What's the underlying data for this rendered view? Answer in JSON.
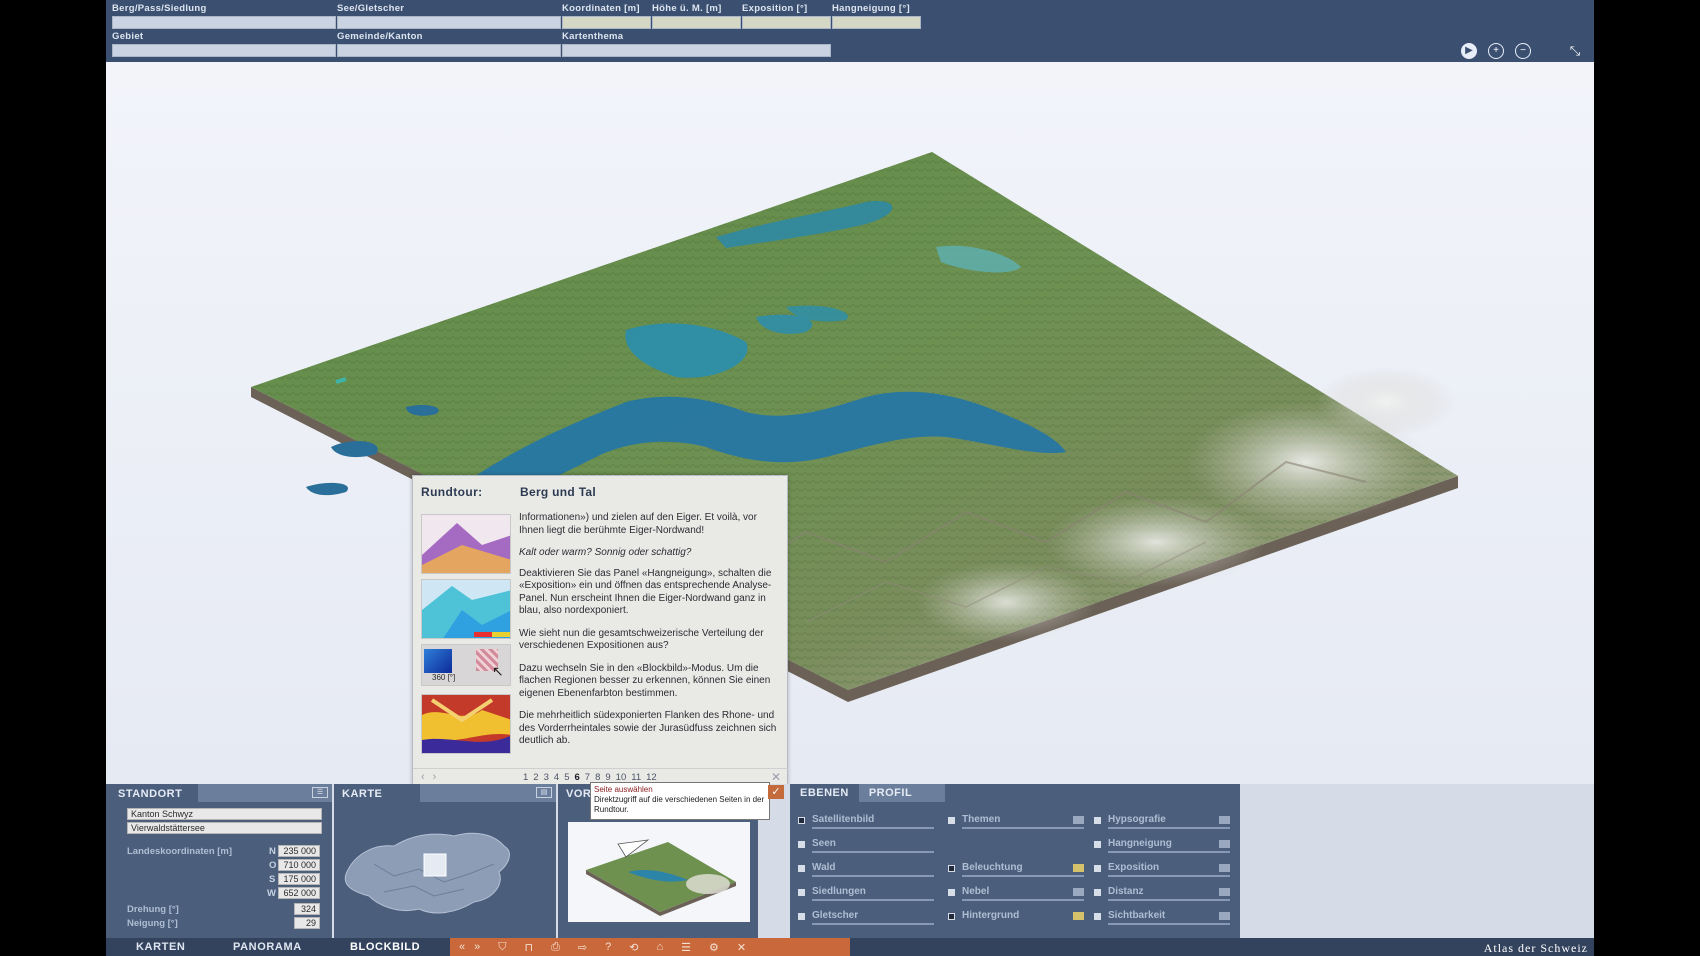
{
  "topbar": {
    "fields": [
      {
        "label": "Berg/Pass/Siedlung"
      },
      {
        "label": "See/Gletscher"
      },
      {
        "label": "Koordinaten [m]"
      },
      {
        "label": "Höhe ü. M. [m]"
      },
      {
        "label": "Exposition [°]"
      },
      {
        "label": "Hangneigung [°]"
      },
      {
        "label": "Gebiet"
      },
      {
        "label": "Gemeinde/Kanton"
      },
      {
        "label": "Kartenthema"
      }
    ],
    "icons": [
      "play-icon",
      "zoom-in-icon",
      "zoom-out-icon",
      "fullscreen-icon"
    ]
  },
  "tour": {
    "label": "Rundtour:",
    "title": "Berg und Tal",
    "paragraphs": [
      "Informationen») und zielen auf den Eiger. Et voilà, vor Ihnen liegt die berühmte Eiger-Nordwand!",
      "Kalt oder warm? Sonnig oder schattig?",
      "Deaktivieren Sie das Panel «Hangneigung», schalten die «Exposition» ein und öffnen das entsprechende Analyse-Panel. Nun erscheint Ihnen die Eiger-Nordwand ganz in blau, also nordexponiert.",
      "Wie sieht nun die gesamtschweizerische Verteilung der verschiedenen Expositionen aus?",
      "Dazu wechseln Sie in den «Blockbild»-Modus. Um die flachen Regionen besser zu erkennen, können Sie einen eigenen Ebenenfarbton bestimmen.",
      "Die mehrheitlich südexponierten Flanken des Rhone- und des Vorderrheintales sowie der Jurasüdfuss zeichnen sich deutlich ab."
    ],
    "thumb_caption": "360 [°]",
    "pages": [
      "1",
      "2",
      "3",
      "4",
      "5",
      "6",
      "7",
      "8",
      "9",
      "10",
      "11",
      "12"
    ],
    "current_page": "6"
  },
  "tooltip": {
    "title": "Seite auswählen",
    "text": "Direktzugriff auf die verschiedenen Seiten in der Rundtour."
  },
  "standort": {
    "title": "STANDORT",
    "kanton": "Kanton Schwyz",
    "see": "Vierwaldstättersee",
    "coords_label": "Landeskoordinaten [m]",
    "coords": [
      {
        "dir": "N",
        "val": "235 000"
      },
      {
        "dir": "O",
        "val": "710 000"
      },
      {
        "dir": "S",
        "val": "175 000"
      },
      {
        "dir": "W",
        "val": "652 000"
      }
    ],
    "drehung_label": "Drehung [°]",
    "drehung": "324",
    "neigung_label": "Neigung [°]",
    "neigung": "29"
  },
  "karte": {
    "title": "KARTE"
  },
  "vorschau": {
    "title": "VOR"
  },
  "ebenen": {
    "tabs": [
      "EBENEN",
      "PROFIL"
    ],
    "active_tab": "PROFIL",
    "col1": [
      {
        "name": "Satellitenbild",
        "on": true
      },
      {
        "name": "Seen",
        "on": false
      },
      {
        "name": "Wald",
        "on": false
      },
      {
        "name": "Siedlungen",
        "on": false
      },
      {
        "name": "Gletscher",
        "on": false
      }
    ],
    "col2": [
      {
        "name": "Themen",
        "on": false
      },
      {
        "name": "Beleuchtung",
        "on": true
      },
      {
        "name": "Nebel",
        "on": false
      },
      {
        "name": "Hintergrund",
        "on": true
      }
    ],
    "col3": [
      {
        "name": "Hypsografie",
        "on": false
      },
      {
        "name": "Hangneigung",
        "on": false
      },
      {
        "name": "Exposition",
        "on": false
      },
      {
        "name": "Distanz",
        "on": false
      },
      {
        "name": "Sichtbarkeit",
        "on": false
      }
    ]
  },
  "navbar": {
    "tabs": [
      "KARTEN",
      "PANORAMA",
      "BLOCKBILD"
    ],
    "active": "BLOCKBILD",
    "brand": "Atlas der Schweiz"
  },
  "colors": {
    "topbar": "#3b5070",
    "panel": "#4b5f7d",
    "toolstrip": "#c9683a",
    "terrain_green": "#6c8f4e",
    "lake": "#2b86b0"
  }
}
